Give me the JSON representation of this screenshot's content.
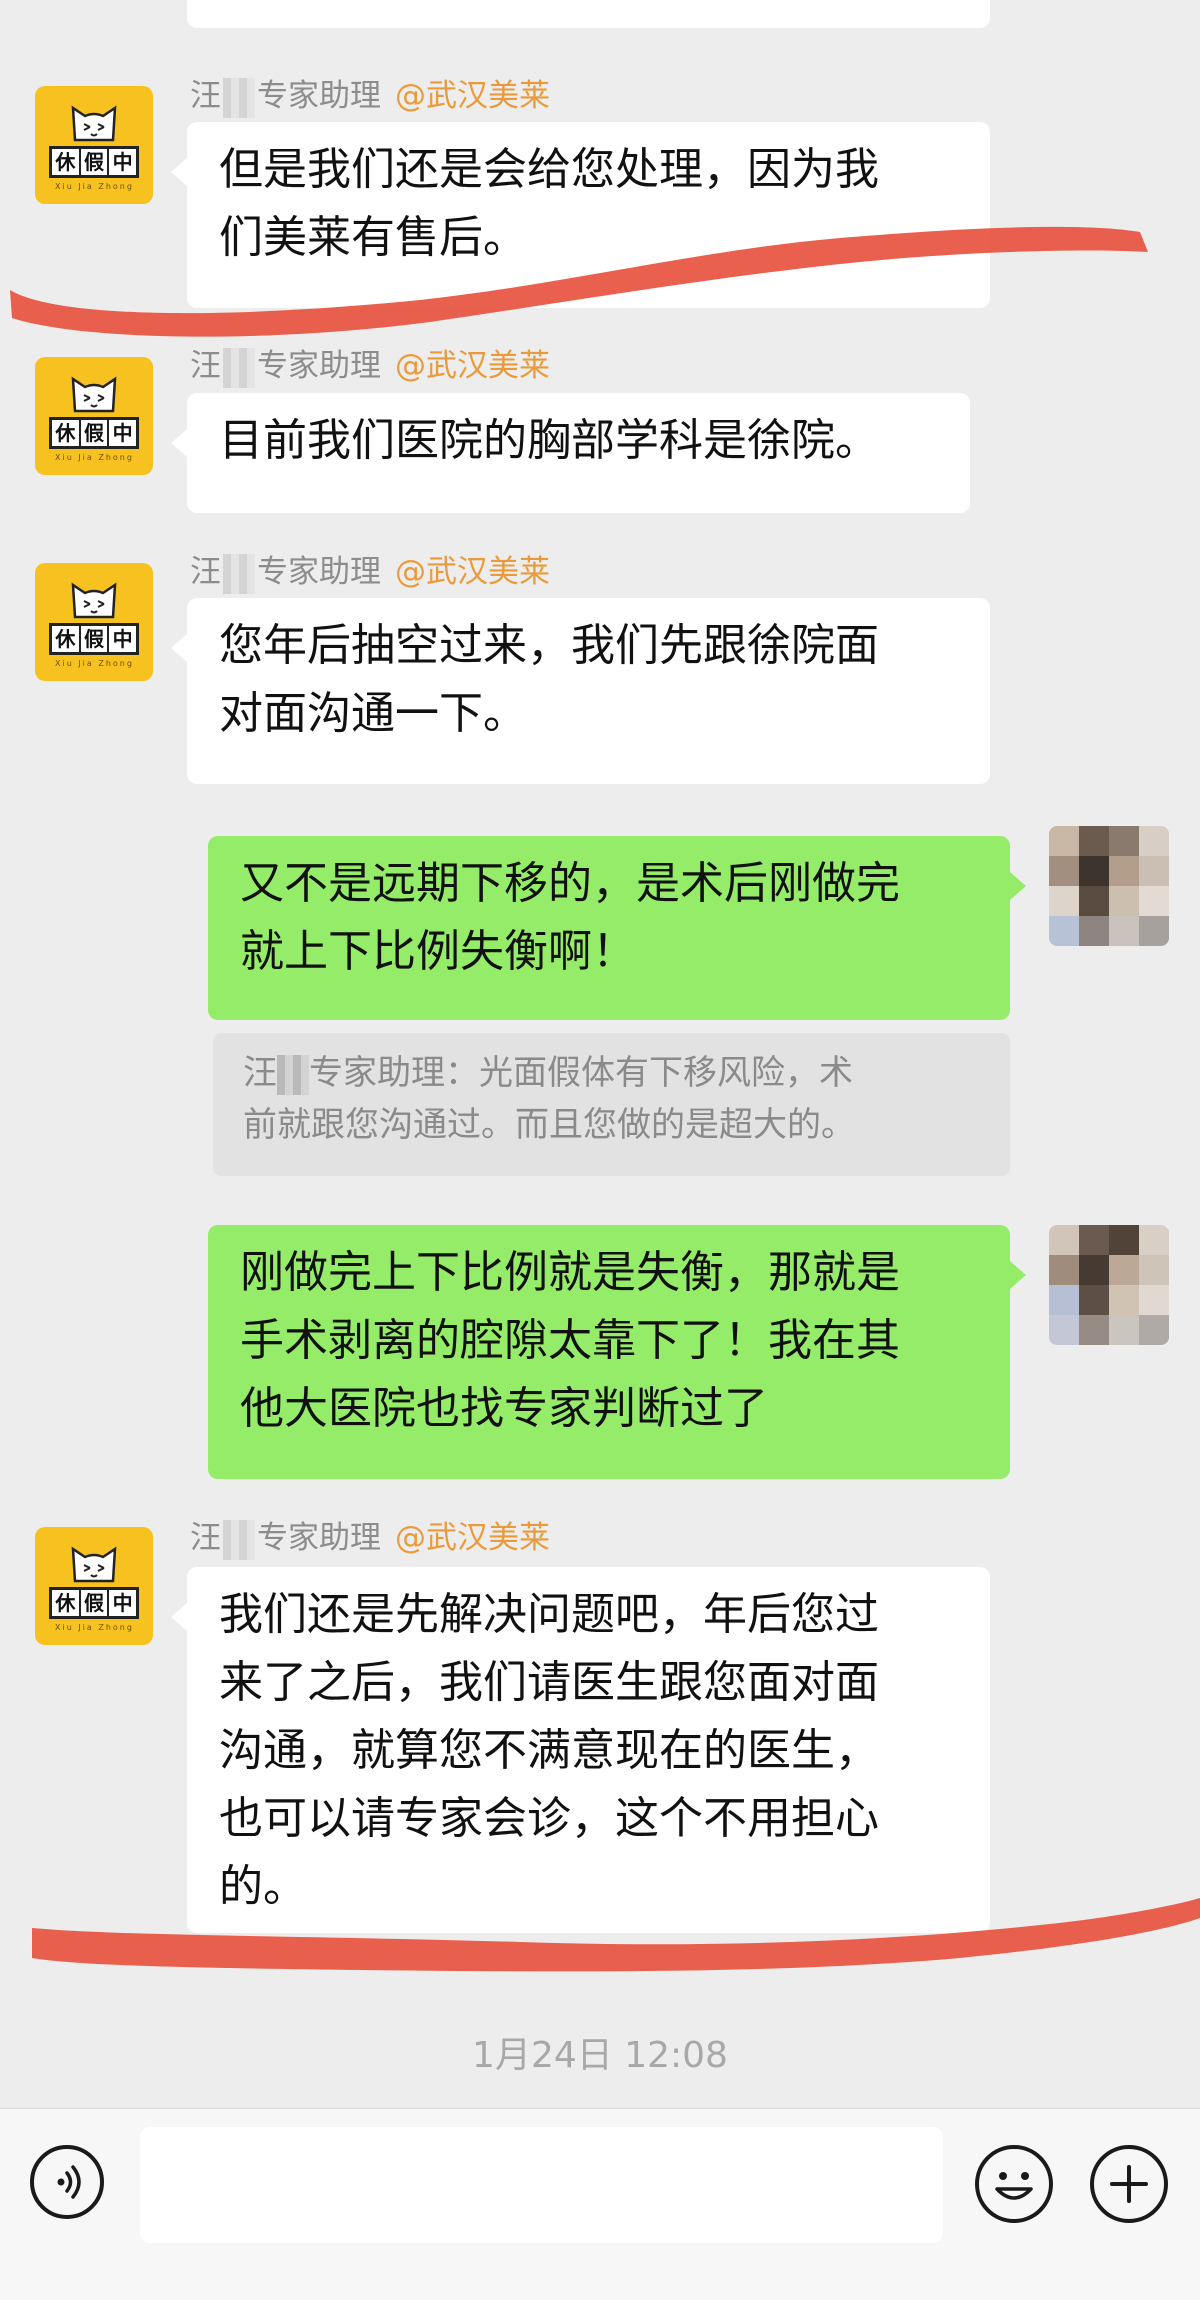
{
  "messages": {
    "sender_prefix": "汪",
    "sender_suffix": "专家助理",
    "sender_tag": "@武汉美莱",
    "m1_lines": [
      "但是我们还是会给您处理，因为我",
      "们美莱有售后。"
    ],
    "m2_lines": [
      "目前我们医院的胸部学科是徐院。"
    ],
    "m3_lines": [
      "您年后抽空过来，我们先跟徐院面",
      "对面沟通一下。"
    ],
    "m4_lines": [
      "又不是远期下移的，是术后刚做完",
      "就上下比例失衡啊！"
    ],
    "quote_prefix": "汪",
    "quote_lines": [
      "专家助理：光面假体有下移风险，术",
      "前就跟您沟通过。而且您做的是超大的。"
    ],
    "m5_lines": [
      "刚做完上下比例就是失衡，那就是",
      "手术剥离的腔隙太靠下了！我在其",
      "他大医院也找专家判断过了"
    ],
    "m6_lines": [
      "我们还是先解决问题吧，年后您过",
      "来了之后，我们请医生跟您面对面",
      "沟通，就算您不满意现在的医生，",
      "也可以请专家会诊，这个不用担心",
      "的。"
    ]
  },
  "avatar": {
    "plate_chars": [
      "休",
      "假",
      "中"
    ],
    "sub_text": "Xiu Jia Zhong"
  },
  "timestamp": "1月24日 12:08",
  "colors": {
    "background": "#ededed",
    "sender_tag": "#eb9a3a",
    "my_bubble": "#95ec69",
    "their_bubble": "#ffffff",
    "annotation_stroke": "#e8533f"
  },
  "icons": {
    "voice": "voice-icon",
    "emoji": "emoji-icon",
    "more": "plus-icon"
  }
}
